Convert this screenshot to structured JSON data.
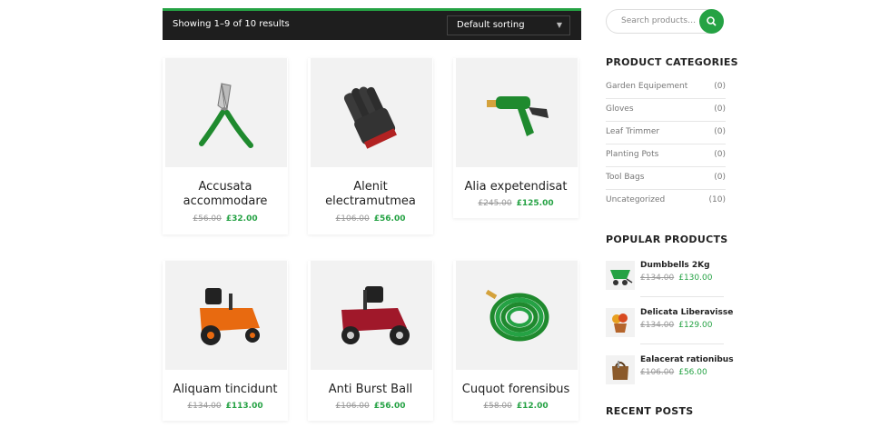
{
  "toolbar": {
    "result_count": "Showing 1–9 of 10 results",
    "sort_selected": "Default sorting"
  },
  "products": [
    {
      "title": "Accusata accommodare",
      "old_price": "£56.00",
      "new_price": "£32.00",
      "icon": "pruning-shears"
    },
    {
      "title": "Alenit electramutmea",
      "old_price": "£106.00",
      "new_price": "£56.00",
      "icon": "garden-gloves"
    },
    {
      "title": "Alia expetendisat",
      "old_price": "£245.00",
      "new_price": "£125.00",
      "icon": "hose-nozzle"
    },
    {
      "title": "Aliquam tincidunt",
      "old_price": "£134.00",
      "new_price": "£113.00",
      "icon": "riding-mower-orange"
    },
    {
      "title": "Anti Burst Ball",
      "old_price": "£106.00",
      "new_price": "£56.00",
      "icon": "riding-mower-red"
    },
    {
      "title": "Cuquot forensibus",
      "old_price": "£58.00",
      "new_price": "£12.00",
      "icon": "garden-hose"
    }
  ],
  "sidebar": {
    "search_placeholder": "Search products…",
    "categories_heading": "PRODUCT CATEGORIES",
    "categories": [
      {
        "name": "Garden Equipement",
        "count": "(0)"
      },
      {
        "name": "Gloves",
        "count": "(0)"
      },
      {
        "name": "Leaf Trimmer",
        "count": "(0)"
      },
      {
        "name": "Planting Pots",
        "count": "(0)"
      },
      {
        "name": "Tool Bags",
        "count": "(0)"
      },
      {
        "name": "Uncategorized",
        "count": "(10)"
      }
    ],
    "popular_heading": "POPULAR PRODUCTS",
    "popular": [
      {
        "name": "Dumbbells 2Kg",
        "old_price": "£134.00",
        "new_price": "£130.00",
        "icon": "wheelbarrow"
      },
      {
        "name": "Delicata Liberavisse",
        "old_price": "£134.00",
        "new_price": "£129.00",
        "icon": "flower-pot"
      },
      {
        "name": "Ealacerat rationibus",
        "old_price": "£106.00",
        "new_price": "£56.00",
        "icon": "tool-bag"
      }
    ],
    "recent_heading": "RECENT POSTS"
  },
  "colors": {
    "accent": "#25a244",
    "toolbar_bg": "#1e1e1e",
    "card_image_bg": "#f2f2f2"
  }
}
